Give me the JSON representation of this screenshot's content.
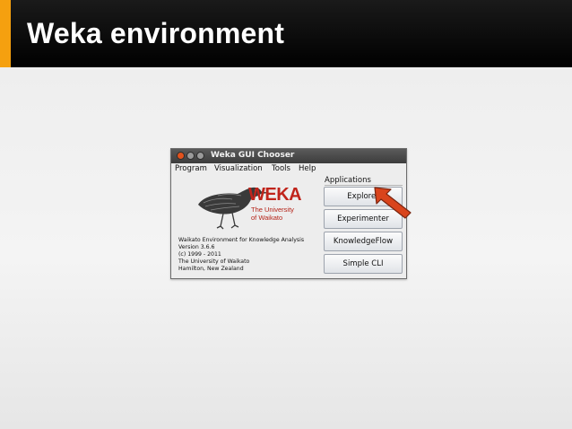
{
  "slide": {
    "title": "Weka environment"
  },
  "window": {
    "title": "Weka GUI Chooser",
    "menu": [
      "Program",
      "Visualization",
      "Tools",
      "Help"
    ],
    "logo": {
      "wordmark": "WEKA",
      "university_line1": "The University",
      "university_line2": "of Waikato"
    },
    "info_lines": [
      "Waikato Environment for Knowledge Analysis",
      "Version 3.6.6",
      "(c) 1999 - 2011",
      "The University of Waikato",
      "Hamilton, New Zealand"
    ],
    "applications": {
      "label": "Applications",
      "buttons": [
        "Explorer",
        "Experimenter",
        "KnowledgeFlow",
        "Simple CLI"
      ]
    }
  },
  "colors": {
    "accent": "#f5a00f",
    "arrow": "#d9441c",
    "weka_red": "#c0241b"
  },
  "icons": {
    "close": "close-icon",
    "minimize": "minimize-icon",
    "maximize": "maximize-icon",
    "logo_bird": "weka-bird-icon",
    "pointer": "arrow-pointer-icon"
  }
}
